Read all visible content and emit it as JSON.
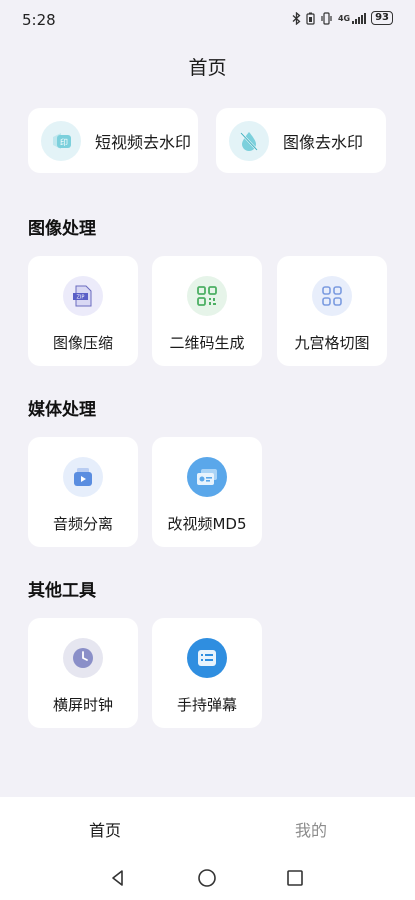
{
  "status": {
    "time": "5:28",
    "network": "4G",
    "battery": "93"
  },
  "header": {
    "title": "首页"
  },
  "top_actions": [
    {
      "label": "短视频去水印",
      "icon": "video-watermark-icon"
    },
    {
      "label": "图像去水印",
      "icon": "image-watermark-icon"
    }
  ],
  "sections": [
    {
      "title": "图像处理",
      "items": [
        {
          "label": "图像压缩",
          "icon": "zip-file-icon"
        },
        {
          "label": "二维码生成",
          "icon": "qr-code-icon"
        },
        {
          "label": "九宫格切图",
          "icon": "grid-icon"
        }
      ]
    },
    {
      "title": "媒体处理",
      "items": [
        {
          "label": "音频分离",
          "icon": "audio-separate-icon"
        },
        {
          "label": "改视频MD5",
          "icon": "id-card-icon"
        }
      ]
    },
    {
      "title": "其他工具",
      "items": [
        {
          "label": "横屏时钟",
          "icon": "clock-icon"
        },
        {
          "label": "手持弹幕",
          "icon": "message-icon"
        }
      ]
    }
  ],
  "tabs": [
    {
      "label": "首页",
      "active": true
    },
    {
      "label": "我的",
      "active": false
    }
  ],
  "colors": {
    "background": "#f2f1f7",
    "active_tab": "#1a1a1a",
    "inactive_tab": "#8c8c8c"
  }
}
